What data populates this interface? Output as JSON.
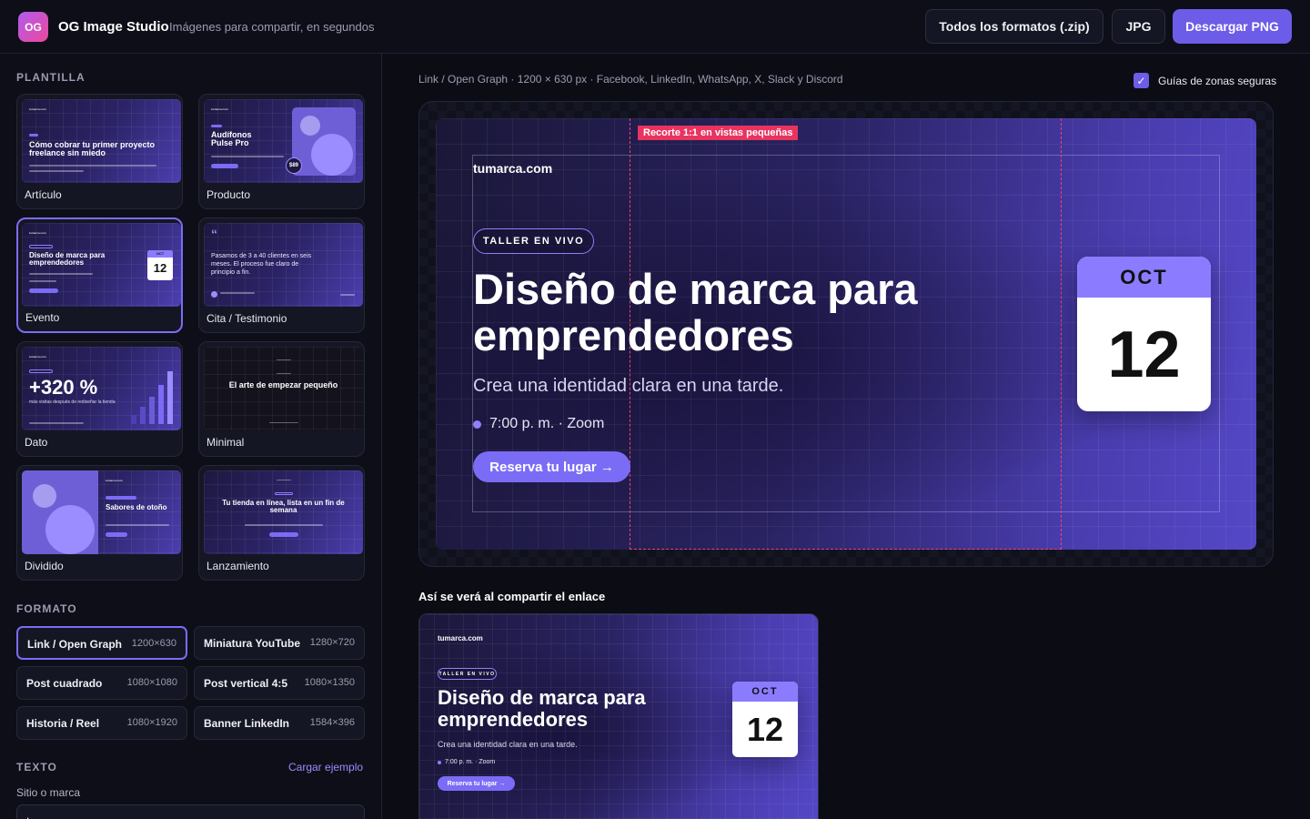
{
  "app": {
    "logo": "OG",
    "title": "OG Image Studio",
    "tagline": "Imágenes para compartir, en segundos"
  },
  "toolbar": {
    "zip_label": "Todos los formatos (.zip)",
    "jpg_label": "JPG",
    "png_label": "Descargar PNG"
  },
  "sidebar": {
    "template_section": "PLANTILLA",
    "templates": [
      {
        "name": "Artículo",
        "thumb_title": "Cómo cobrar tu primer proyecto freelance sin miedo"
      },
      {
        "name": "Producto",
        "thumb_title": "Audífonos Pulse Pro",
        "thumb_price": "$89"
      },
      {
        "name": "Evento",
        "thumb_title": "Diseño de marca para emprendedores",
        "active": true
      },
      {
        "name": "Cita / Testimonio",
        "thumb_title": "Pasamos de 3 a 40 clientes en seis meses. El proceso fue claro de principio a fin."
      },
      {
        "name": "Dato",
        "thumb_title": "+320 %",
        "thumb_sub": "más visitas después de rediseñar la tienda"
      },
      {
        "name": "Minimal",
        "thumb_title": "El arte de empezar pequeño"
      },
      {
        "name": "Dividido",
        "thumb_title": "Sabores de otoño"
      },
      {
        "name": "Lanzamiento",
        "thumb_title": "Tu tienda en línea, lista en un fin de semana"
      }
    ],
    "format_section": "FORMATO",
    "formats": [
      {
        "name": "Link / Open Graph",
        "size": "1200×630",
        "active": true
      },
      {
        "name": "Miniatura YouTube",
        "size": "1280×720"
      },
      {
        "name": "Post cuadrado",
        "size": "1080×1080"
      },
      {
        "name": "Post vertical 4:5",
        "size": "1080×1350"
      },
      {
        "name": "Historia / Reel",
        "size": "1080×1920"
      },
      {
        "name": "Banner LinkedIn",
        "size": "1584×396"
      }
    ],
    "text_section": "TEXTO",
    "load_sample": "Cargar ejemplo",
    "site_label": "Sitio o marca",
    "site_value": "tumarca.com"
  },
  "main": {
    "meta": "Link / Open Graph · 1200 × 630 px · Facebook, LinkedIn, WhatsApp, X, Slack y Discord",
    "safe_zone_label": "Guías de zonas seguras",
    "safe_zone_checked": true,
    "crop_tag": "Recorte 1:1 en vistas pequeñas",
    "preview_heading": "Así se verá al compartir el enlace"
  },
  "og": {
    "brand": "tumarca.com",
    "badge": "TALLER EN VIVO",
    "title_line1": "Diseño de marca para",
    "title_line2": "emprendedores",
    "subtitle": "Crea una identidad clara en una tarde.",
    "when": "7:00 p. m. · Zoom",
    "cta": "Reserva tu lugar  →",
    "month": "OCT",
    "day": "12",
    "accent": "#7b6cf6"
  }
}
